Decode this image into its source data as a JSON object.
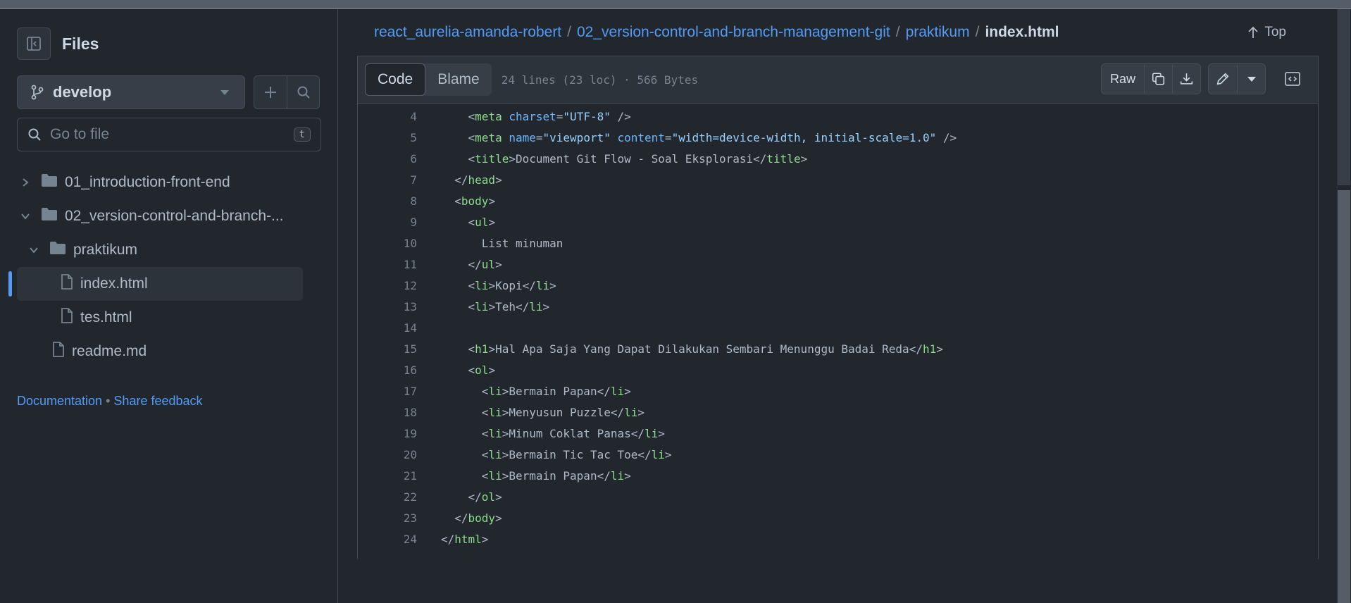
{
  "sidebar": {
    "title": "Files",
    "branch": "develop",
    "search_placeholder": "Go to file",
    "search_shortcut": "t",
    "tree": [
      {
        "label": "01_introduction-front-end",
        "type": "folder",
        "expanded": false,
        "depth": 0
      },
      {
        "label": "02_version-control-and-branch-...",
        "type": "folder",
        "expanded": true,
        "depth": 0
      },
      {
        "label": "praktikum",
        "type": "folder",
        "expanded": true,
        "depth": 1
      },
      {
        "label": "index.html",
        "type": "file",
        "selected": true,
        "depth": 2
      },
      {
        "label": "tes.html",
        "type": "file",
        "depth": 2
      },
      {
        "label": "readme.md",
        "type": "file",
        "depth": 1
      }
    ],
    "links": {
      "documentation": "Documentation",
      "separator": "•",
      "feedback": "Share feedback"
    }
  },
  "breadcrumb": {
    "items": [
      "react_aurelia-amanda-robert",
      "02_version-control-and-branch-management-git",
      "praktikum"
    ],
    "separator": "/",
    "current": "index.html"
  },
  "top_link": "Top",
  "toolbar": {
    "tabs": [
      "Code",
      "Blame"
    ],
    "active_tab": "Code",
    "meta": "24 lines (23 loc) · 566 Bytes",
    "raw_label": "Raw"
  },
  "code_lines": [
    {
      "n": "4",
      "text": "    <meta charset=\"UTF-8\" />"
    },
    {
      "n": "5",
      "text": "    <meta name=\"viewport\" content=\"width=device-width, initial-scale=1.0\" />"
    },
    {
      "n": "6",
      "text": "    <title>Document Git Flow - Soal Eksplorasi</title>"
    },
    {
      "n": "7",
      "text": "  </head>"
    },
    {
      "n": "8",
      "text": "  <body>"
    },
    {
      "n": "9",
      "text": "    <ul>"
    },
    {
      "n": "10",
      "text": "      List minuman"
    },
    {
      "n": "11",
      "text": "    </ul>"
    },
    {
      "n": "12",
      "text": "    <li>Kopi</li>"
    },
    {
      "n": "13",
      "text": "    <li>Teh</li>"
    },
    {
      "n": "14",
      "text": ""
    },
    {
      "n": "15",
      "text": "    <h1>Hal Apa Saja Yang Dapat Dilakukan Sembari Menunggu Badai Reda</h1>"
    },
    {
      "n": "16",
      "text": "    <ol>"
    },
    {
      "n": "17",
      "text": "      <li>Bermain Papan</li>"
    },
    {
      "n": "18",
      "text": "      <li>Menyusun Puzzle</li>"
    },
    {
      "n": "19",
      "text": "      <li>Minum Coklat Panas</li>"
    },
    {
      "n": "20",
      "text": "      <li>Bermain Tic Tac Toe</li>"
    },
    {
      "n": "21",
      "text": "      <li>Bermain Papan</li>"
    },
    {
      "n": "22",
      "text": "    </ol>"
    },
    {
      "n": "23",
      "text": "  </body>"
    },
    {
      "n": "24",
      "text": "</html>"
    }
  ],
  "colors": {
    "background": "#22272e",
    "accent": "#539bf5",
    "tag": "#8ddb8c",
    "attr": "#6cb6ff",
    "string": "#96d0ff"
  },
  "icons": [
    "sidebar-collapse-icon",
    "git-branch-icon",
    "plus-icon",
    "search-icon",
    "chevron-right-icon",
    "chevron-down-icon",
    "folder-icon",
    "file-icon",
    "arrow-up-icon",
    "copy-icon",
    "download-icon",
    "pencil-icon",
    "caret-down-icon",
    "code-square-icon"
  ]
}
